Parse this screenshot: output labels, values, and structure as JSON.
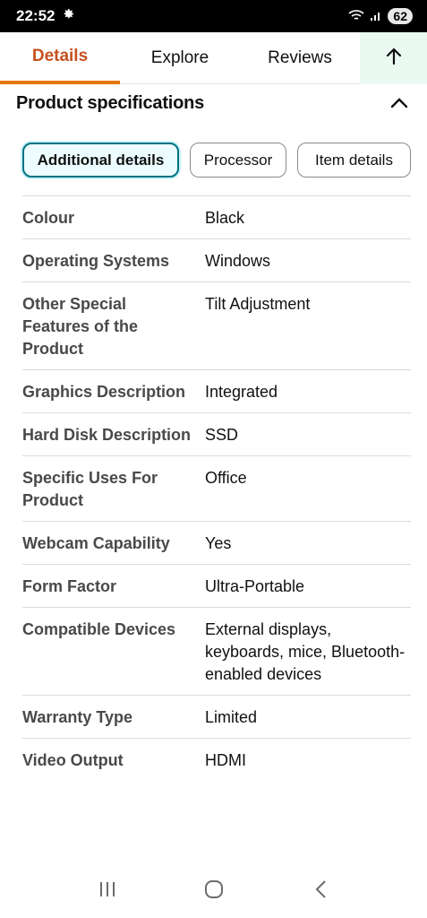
{
  "status_bar": {
    "time": "22:52",
    "battery": "62"
  },
  "tabs": [
    {
      "label": "Details"
    },
    {
      "label": "Explore"
    },
    {
      "label": "Reviews"
    }
  ],
  "section": {
    "title": "Product specifications"
  },
  "chips": [
    {
      "label": "Additional details"
    },
    {
      "label": "Processor"
    },
    {
      "label": "Item details"
    }
  ],
  "specs": [
    {
      "label": "Colour",
      "value": "Black"
    },
    {
      "label": "Operating Systems",
      "value": "Windows"
    },
    {
      "label": "Other Special Features of the Product",
      "value": "Tilt Adjustment"
    },
    {
      "label": "Graphics Description",
      "value": "Integrated"
    },
    {
      "label": "Hard Disk Description",
      "value": "SSD"
    },
    {
      "label": "Specific Uses For Product",
      "value": "Office"
    },
    {
      "label": "Webcam Capability",
      "value": "Yes"
    },
    {
      "label": "Form Factor",
      "value": "Ultra-Portable"
    },
    {
      "label": "Compatible Devices",
      "value": "External displays, keyboards, mice, Bluetooth-enabled devices"
    },
    {
      "label": "Warranty Type",
      "value": "Limited"
    },
    {
      "label": "Video Output",
      "value": "HDMI"
    }
  ],
  "colors": {
    "accent_orange": "#e77600",
    "chip_active_border": "#007185",
    "top_button_bg": "#eafaf3"
  }
}
